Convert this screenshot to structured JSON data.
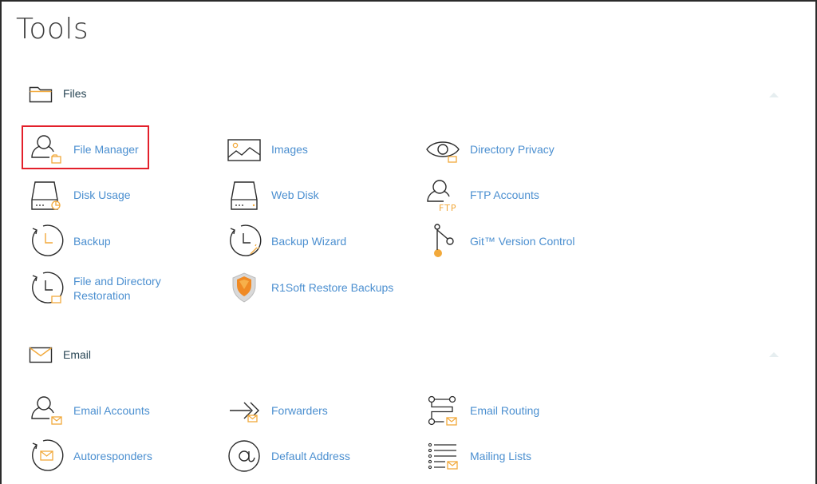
{
  "page": {
    "title": "Tools"
  },
  "colors": {
    "label": "#4b8fd0",
    "icon_stroke": "#2b2b2b",
    "accent": "#f2a93b",
    "highlight": "#e3202b"
  },
  "groups": {
    "files": {
      "label": "Files",
      "icon": "folder-icon",
      "items": [
        {
          "label": "File Manager",
          "icon": "file-manager-icon"
        },
        {
          "label": "Images",
          "icon": "image-icon"
        },
        {
          "label": "Directory Privacy",
          "icon": "eye-icon"
        },
        {
          "label": "Disk Usage",
          "icon": "disk-usage-icon"
        },
        {
          "label": "Web Disk",
          "icon": "web-disk-icon"
        },
        {
          "label": "FTP Accounts",
          "icon": "ftp-accounts-icon"
        },
        {
          "label": "Backup",
          "icon": "backup-icon"
        },
        {
          "label": "Backup Wizard",
          "icon": "backup-wizard-icon"
        },
        {
          "label": "Git™ Version Control",
          "icon": "git-icon"
        },
        {
          "label": "File and Directory Restoration",
          "icon": "restore-icon"
        },
        {
          "label": "R1Soft Restore Backups",
          "icon": "r1soft-shield-icon"
        }
      ]
    },
    "email": {
      "label": "Email",
      "icon": "envelope-icon",
      "items": [
        {
          "label": "Email Accounts",
          "icon": "email-accounts-icon"
        },
        {
          "label": "Forwarders",
          "icon": "forwarders-icon"
        },
        {
          "label": "Email Routing",
          "icon": "email-routing-icon"
        },
        {
          "label": "Autoresponders",
          "icon": "autoresponders-icon"
        },
        {
          "label": "Default Address",
          "icon": "at-sign-icon"
        },
        {
          "label": "Mailing Lists",
          "icon": "mailing-lists-icon"
        }
      ]
    }
  }
}
